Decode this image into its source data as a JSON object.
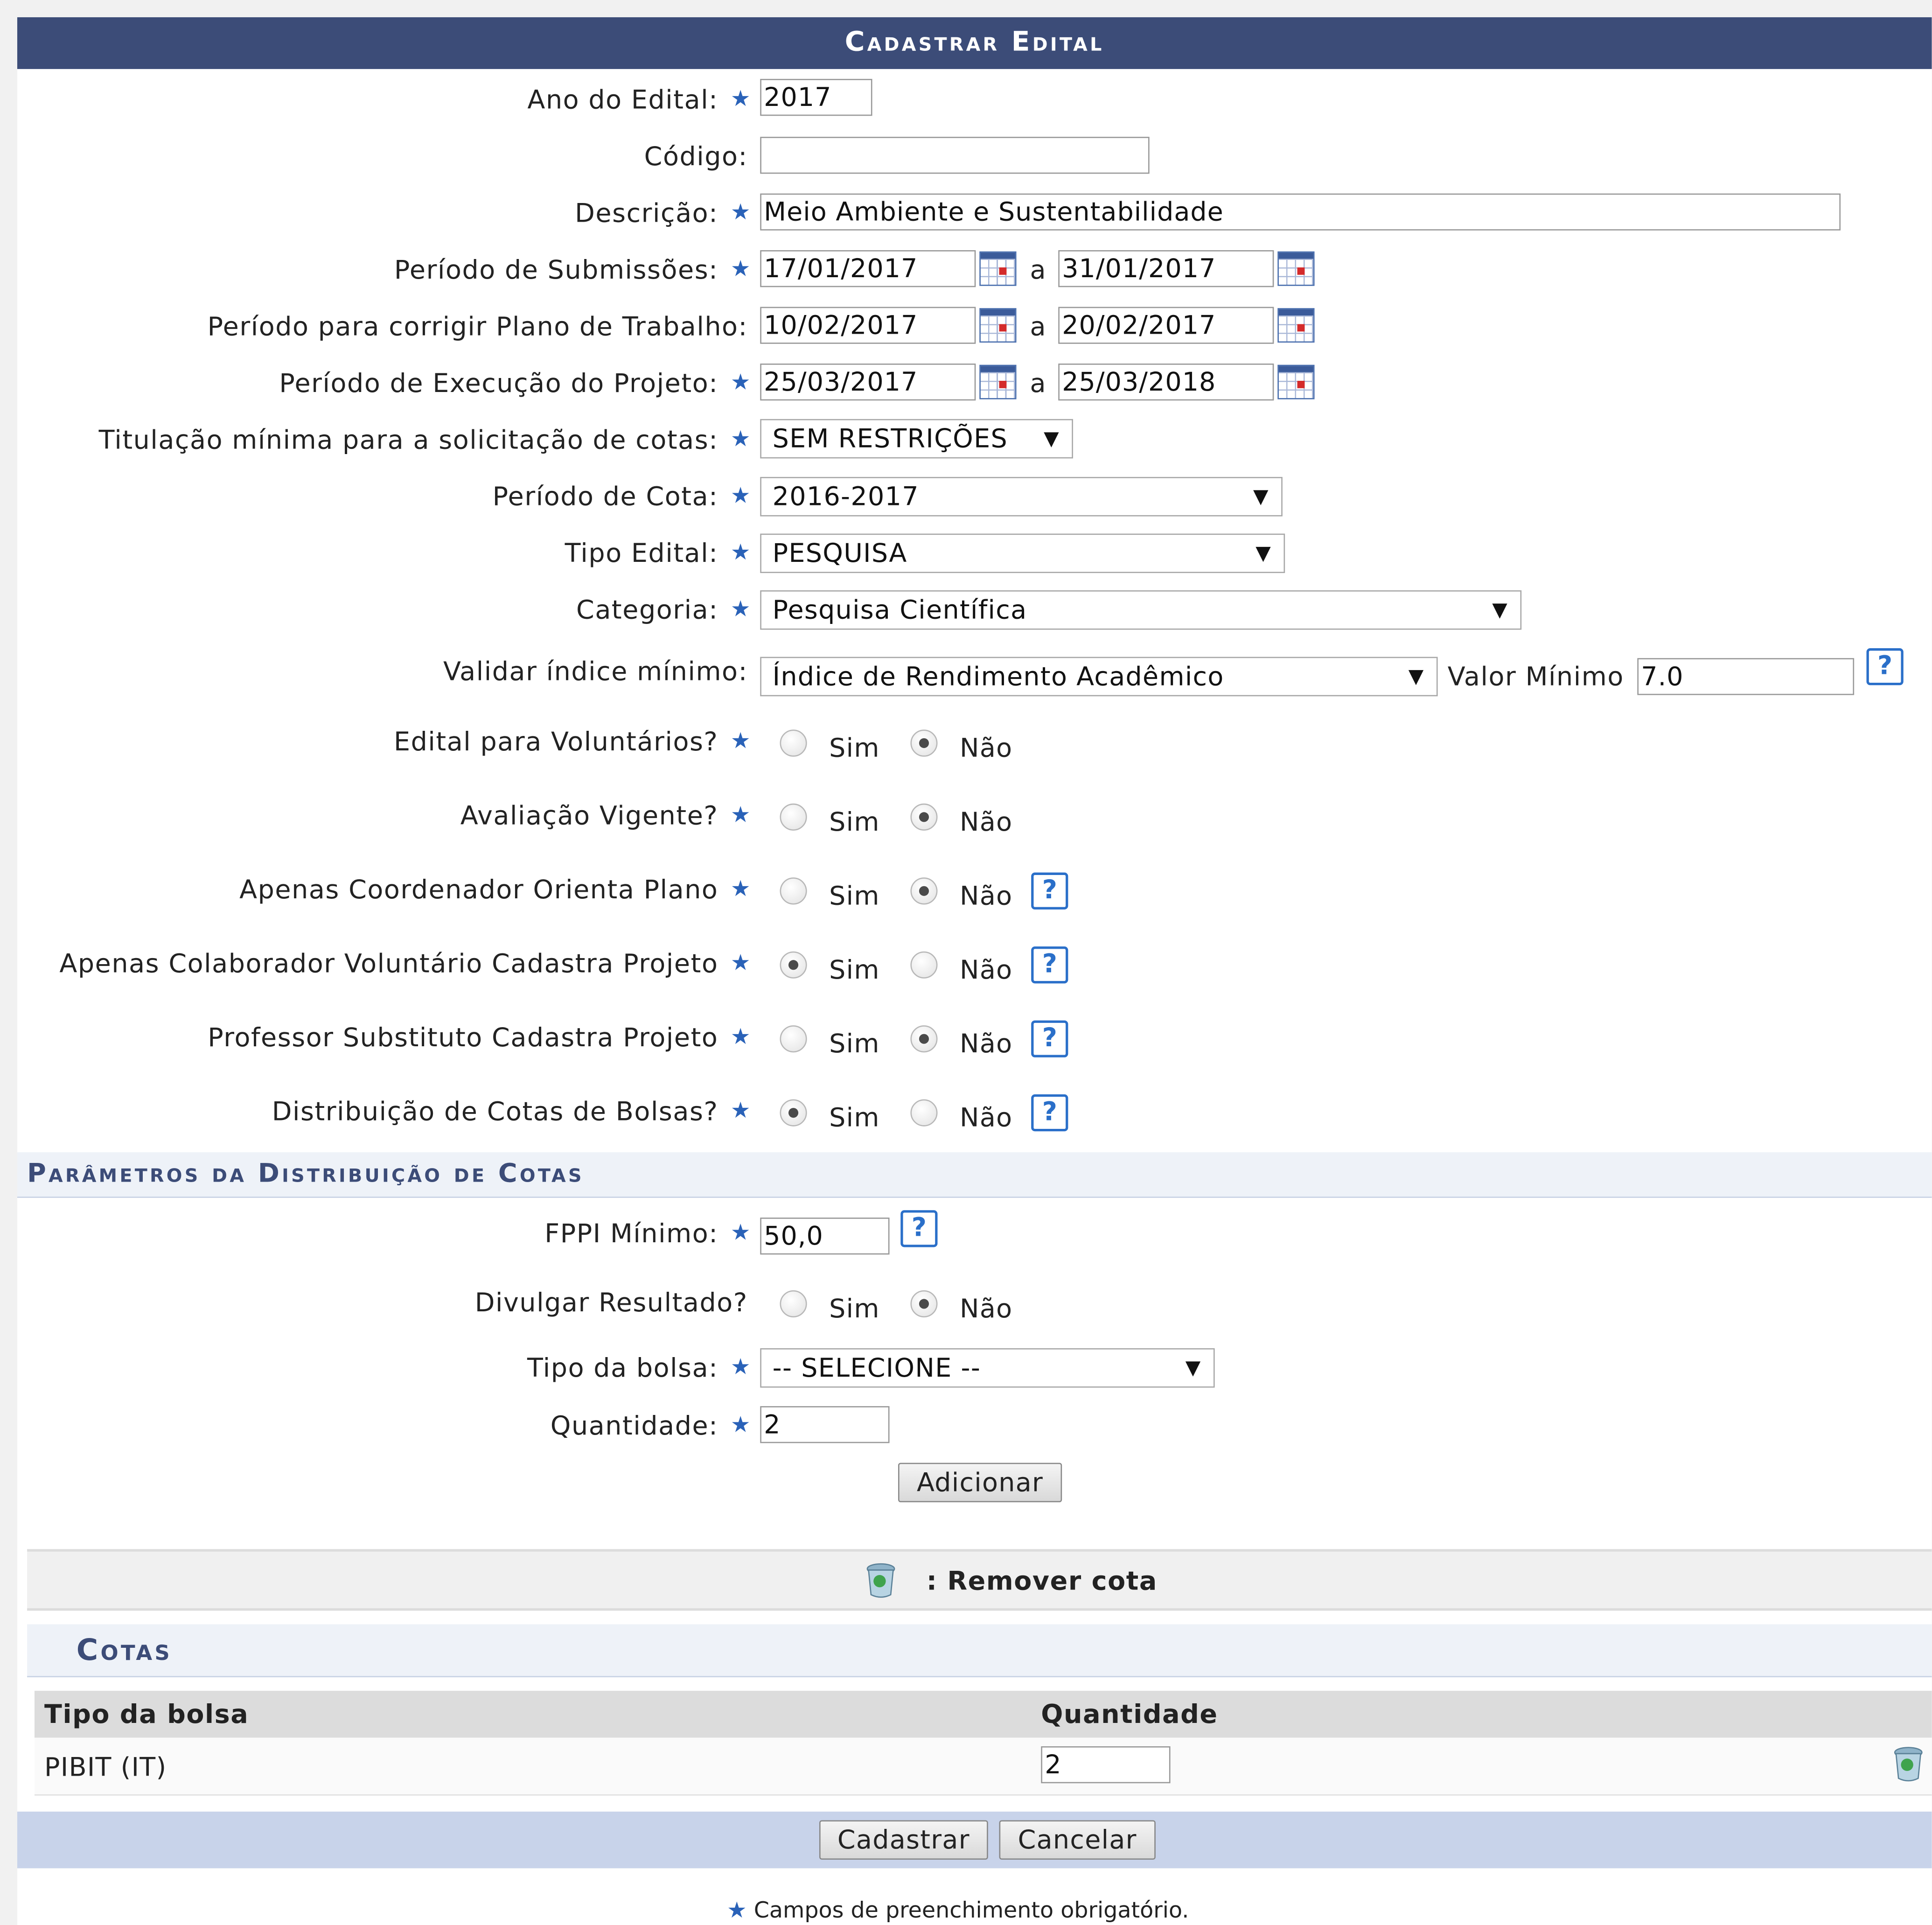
{
  "form": {
    "title": "Cadastrar Edital",
    "ano": {
      "label": "Ano do Edital:",
      "value": "2017"
    },
    "codigo": {
      "label": "Código:",
      "value": ""
    },
    "descricao": {
      "label": "Descrição:",
      "value": "Meio Ambiente e Sustentabilidade"
    },
    "submissoes": {
      "label": "Período de Submissões:",
      "from": "17/01/2017",
      "to": "31/01/2017"
    },
    "corrigir": {
      "label": "Período para corrigir Plano de Trabalho:",
      "from": "10/02/2017",
      "to": "20/02/2017"
    },
    "execucao": {
      "label": "Período de Execução do Projeto:",
      "from": "25/03/2017",
      "to": "25/03/2018"
    },
    "range_sep": "a",
    "titulacao": {
      "label": "Titulação mínima para a solicitação de cotas:",
      "value": "SEM RESTRIÇÕES"
    },
    "periodo_cota": {
      "label": "Período de Cota:",
      "value": "2016-2017"
    },
    "tipo_edital": {
      "label": "Tipo Edital:",
      "value": "PESQUISA"
    },
    "categoria": {
      "label": "Categoria:",
      "value": "Pesquisa Científica"
    },
    "indice": {
      "label": "Validar índice mínimo:",
      "value": "Índice de Rendimento Acadêmico",
      "min_label": "Valor Mínimo",
      "min_value": "7.0"
    },
    "yes": "Sim",
    "no": "Não",
    "help": "?",
    "arrow": "▼",
    "star": "★",
    "radios": [
      {
        "label": "Edital para Voluntários?",
        "selected": "no"
      },
      {
        "label": "Avaliação Vigente?",
        "selected": "no"
      },
      {
        "label": "Apenas Coordenador Orienta Plano",
        "selected": "no"
      },
      {
        "label": "Apenas Colaborador Voluntário Cadastra Projeto",
        "selected": "yes"
      },
      {
        "label": "Professor Substituto Cadastra Projeto",
        "selected": "no"
      },
      {
        "label": "Distribuição de Cotas de Bolsas?",
        "selected": "yes"
      }
    ]
  },
  "distribuicao": {
    "title": "Parâmetros da Distribuição de Cotas",
    "fppi": {
      "label": "FPPI Mínimo:",
      "value": "50,0"
    },
    "divulgar": {
      "label": "Divulgar Resultado?",
      "selected": "no"
    },
    "tipo_bolsa": {
      "label": "Tipo da bolsa:",
      "value": "-- SELECIONE --"
    },
    "quantidade": {
      "label": "Quantidade:",
      "value": "2"
    },
    "add_button": "Adicionar"
  },
  "legend": {
    "remove_text": ": Remover cota"
  },
  "cotas": {
    "title": "Cotas",
    "columns": [
      "Tipo da bolsa",
      "Quantidade"
    ],
    "rows": [
      {
        "tipo": "PIBIT (IT)",
        "quantidade": "2"
      }
    ]
  },
  "actions": {
    "submit": "Cadastrar",
    "cancel": "Cancelar"
  },
  "footer_note": "Campos de preenchimento obrigatório."
}
